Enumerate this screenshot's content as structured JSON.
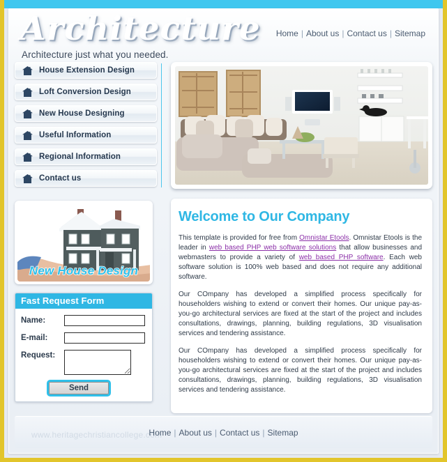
{
  "theme": {
    "outer_border": "#e2c52b",
    "topbar": "#3fc7ef",
    "accent": "#2fb7e4",
    "link": "#8b2fa8",
    "text": "#2e3a48",
    "menu_text": "#26394f"
  },
  "header": {
    "logo": "Architecture",
    "tagline": "Architecture just what you needed."
  },
  "topnav": {
    "items": [
      {
        "label": "Home"
      },
      {
        "label": "About us"
      },
      {
        "label": "Contact us"
      },
      {
        "label": "Sitemap"
      }
    ],
    "separator": "|"
  },
  "sidebar": {
    "menu": [
      {
        "label": "House Extension Design",
        "icon": "house-icon"
      },
      {
        "label": "Loft Conversion Design",
        "icon": "house-icon"
      },
      {
        "label": "New House Designing",
        "icon": "house-icon"
      },
      {
        "label": "Useful Information",
        "icon": "house-icon"
      },
      {
        "label": "Regional Information",
        "icon": "house-icon"
      },
      {
        "label": "Contact us",
        "icon": "house-icon"
      }
    ],
    "promo": {
      "caption": "New House Design",
      "alt": "hand-holding-house-model-image"
    },
    "form": {
      "title": "Fast Request Form",
      "name_label": "Name:",
      "name_value": "",
      "email_label": "E-mail:",
      "email_value": "",
      "request_label": "Request:",
      "request_value": "",
      "send_label": "Send"
    }
  },
  "main": {
    "hero": {
      "alt": "modern-living-room-interior-photo"
    },
    "welcome": {
      "heading": "Welcome to Our Company",
      "paragraph1": {
        "part1": "This template is provided for free from ",
        "link1": "Omnistar Etools",
        "part2": ". Omnistar Etools is the leader in ",
        "link2": "web based PHP web software solutions",
        "part3": " that allow businesses and webmasters to provide a variety of ",
        "link3": "web based PHP software",
        "part4": ". Each web software solution is 100% web based and does not require any additional software."
      },
      "paragraph2": "Our COmpany has developed a simplified process specifically for householders wishing to extend or convert their homes. Our unique pay-as-you-go architectural services are fixed at the start of the project and includes consultations, drawings, planning, building regulations, 3D visualisation services and tendering assistance.",
      "paragraph3": "Our COmpany has developed a simplified process specifically for householders wishing to extend or convert their homes. Our unique pay-as-you-go architectural services are fixed at the start of the project and includes consultations, drawings, planning, building regulations, 3D visualisation services and tendering assistance."
    }
  },
  "footer": {
    "items": [
      {
        "label": "Home"
      },
      {
        "label": "About us"
      },
      {
        "label": "Contact us"
      },
      {
        "label": "Sitemap"
      }
    ],
    "separator": "|",
    "watermark": "www.heritagechristiancollege.com"
  }
}
